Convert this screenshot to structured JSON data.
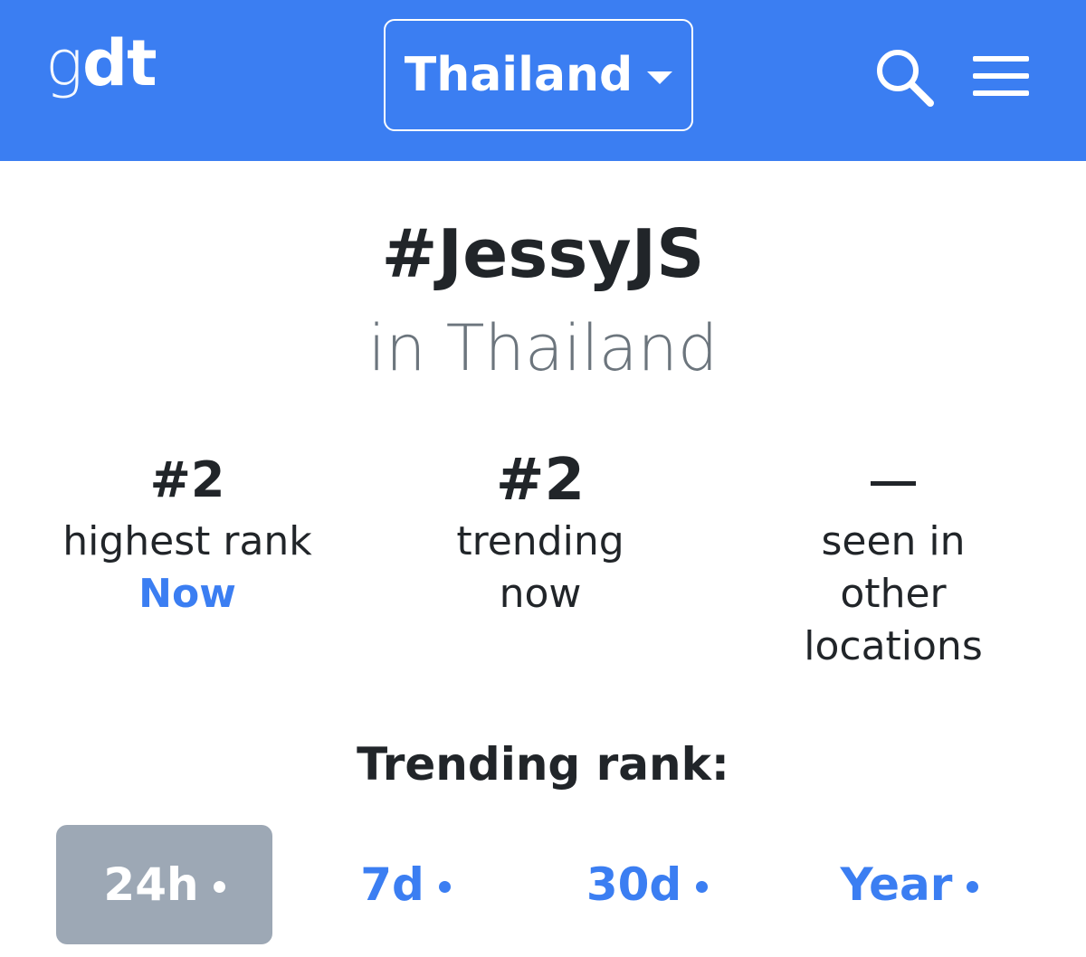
{
  "navbar": {
    "logo_g": "g",
    "logo_dt": "dt",
    "country": "Thailand",
    "colors": {
      "background": "#3b7ef2",
      "foreground": "#ffffff"
    },
    "icons": [
      "search-icon",
      "hamburger-menu-icon"
    ]
  },
  "trend": {
    "title": "#JessyJS",
    "location": "in Thailand"
  },
  "stats": {
    "highest": {
      "value": "#2",
      "label": "highest rank",
      "link": "Now"
    },
    "trending": {
      "value": "#2",
      "label": "trending\nnow"
    },
    "other": {
      "value": "—",
      "label": "seen in\nother\nlocations"
    }
  },
  "rank": {
    "heading": "Trending rank:",
    "tabs": [
      {
        "label": "24h",
        "active": true
      },
      {
        "label": "7d",
        "active": false
      },
      {
        "label": "30d",
        "active": false
      },
      {
        "label": "Year",
        "active": false
      }
    ],
    "colors": {
      "active_bg": "#9da8b5",
      "link": "#3b7ef2"
    }
  }
}
